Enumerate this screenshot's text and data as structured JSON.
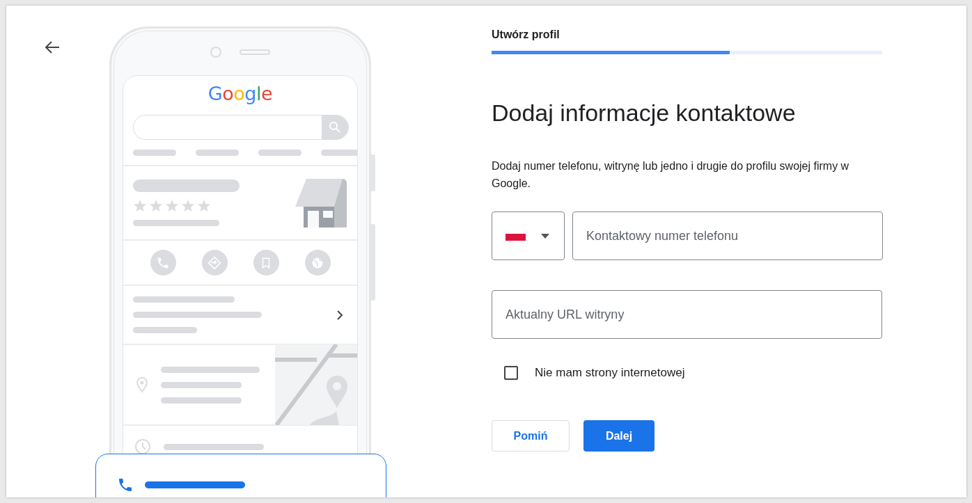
{
  "illustration": {
    "logo": "Google"
  },
  "progress": {
    "step_label": "Utwórz profil",
    "level": 0.61
  },
  "heading": "Dodaj informacje kontaktowe",
  "description": "Dodaj numer telefonu, witrynę lub jedno i drugie do profilu swojej firmy w Google.",
  "phone": {
    "placeholder": "Kontaktowy numer telefonu"
  },
  "website": {
    "placeholder": "Aktualny URL witryny"
  },
  "no_website": {
    "label": "Nie mam strony internetowej",
    "checked": false
  },
  "buttons": [
    {
      "label": "Pomiń",
      "kind": "secondary"
    },
    {
      "label": "Dalej",
      "kind": "primary"
    }
  ]
}
